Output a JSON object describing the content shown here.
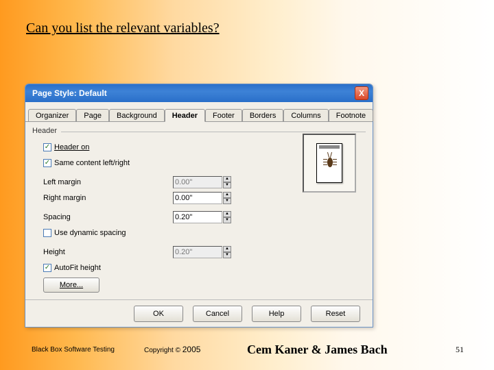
{
  "slide": {
    "title": "Can you list the relevant variables?",
    "page_number": "51"
  },
  "dialog": {
    "window_title": "Page Style: Default",
    "close_icon": "X",
    "tabs": [
      {
        "label": "Organizer",
        "active": false
      },
      {
        "label": "Page",
        "active": false
      },
      {
        "label": "Background",
        "active": false
      },
      {
        "label": "Header",
        "active": true
      },
      {
        "label": "Footer",
        "active": false
      },
      {
        "label": "Borders",
        "active": false
      },
      {
        "label": "Columns",
        "active": false
      },
      {
        "label": "Footnote",
        "active": false
      }
    ],
    "group_label": "Header",
    "controls": {
      "header_on": {
        "label": "Header on",
        "checked": true
      },
      "same_content": {
        "label": "Same content left/right",
        "checked": true
      },
      "left_margin": {
        "label": "Left margin",
        "value": "0.00\"",
        "enabled": false
      },
      "right_margin": {
        "label": "Right margin",
        "value": "0.00\""
      },
      "spacing": {
        "label": "Spacing",
        "value": "0.20\""
      },
      "dynamic_spacing": {
        "label": "Use dynamic spacing",
        "checked": false
      },
      "height": {
        "label": "Height",
        "value": "0.20\"",
        "enabled": false
      },
      "autofit": {
        "label": "AutoFit height",
        "checked": true
      }
    },
    "more_button": "More...",
    "footer_buttons": {
      "ok": "OK",
      "cancel": "Cancel",
      "help": "Help",
      "reset": "Reset"
    }
  },
  "slide_footer": {
    "left": "Black Box Software Testing",
    "copyright": "Copyright ©",
    "year": "2005",
    "authors": "Cem Kaner & James Bach"
  }
}
